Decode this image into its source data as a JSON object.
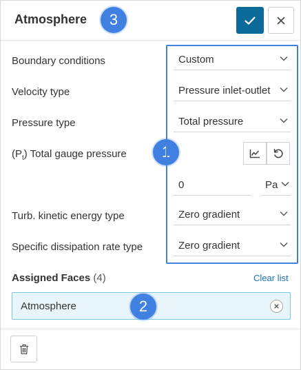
{
  "header": {
    "title": "Atmosphere",
    "badge": "3"
  },
  "form": {
    "boundary_conditions": {
      "label": "Boundary conditions",
      "value": "Custom"
    },
    "velocity_type": {
      "label": "Velocity type",
      "value": "Pressure inlet-outlet"
    },
    "pressure_type": {
      "label": "Pressure type",
      "value": "Total pressure"
    },
    "total_gauge_pressure": {
      "label_prefix": "(P",
      "label_sub": "t",
      "label_suffix": ") Total gauge pressure",
      "value": "0",
      "unit": "Pa",
      "badge": "1"
    },
    "turb_kinetic_energy_type": {
      "label": "Turb. kinetic energy type",
      "value": "Zero gradient"
    },
    "specific_dissipation_rate_type": {
      "label": "Specific dissipation rate type",
      "value": "Zero gradient"
    }
  },
  "assigned_faces": {
    "title": "Assigned Faces",
    "count": "(4)",
    "clear_label": "Clear list",
    "items": [
      {
        "name": "Atmosphere"
      }
    ],
    "badge": "2"
  },
  "icons": {
    "confirm": "check-icon",
    "close": "close-icon",
    "chart": "chart-icon",
    "reset": "reset-icon",
    "delete": "trash-icon"
  },
  "colors": {
    "accent": "#0b6a9a",
    "badge": "#3f80e0",
    "highlight_border": "#3f80e0",
    "link": "#1a73b8",
    "face_bg": "#e8f6fb",
    "face_border": "#79c6e0"
  }
}
